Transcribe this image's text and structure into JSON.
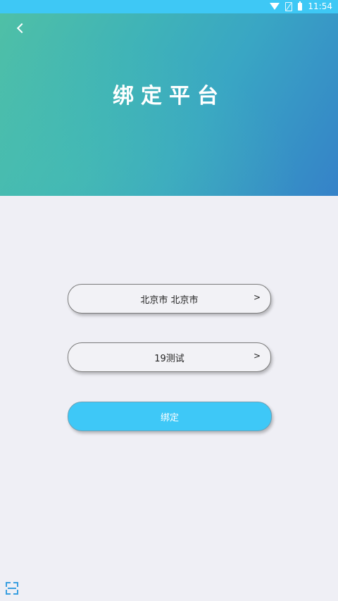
{
  "status_bar": {
    "time": "11:54"
  },
  "header": {
    "title": "绑定平台"
  },
  "form": {
    "region_value": "北京市 北京市",
    "region_arrow": ">",
    "platform_value": "19测试",
    "platform_arrow": ">",
    "bind_label": "绑定"
  },
  "colors": {
    "accent": "#3ec8f7",
    "status_bar": "#3ec8f5"
  }
}
